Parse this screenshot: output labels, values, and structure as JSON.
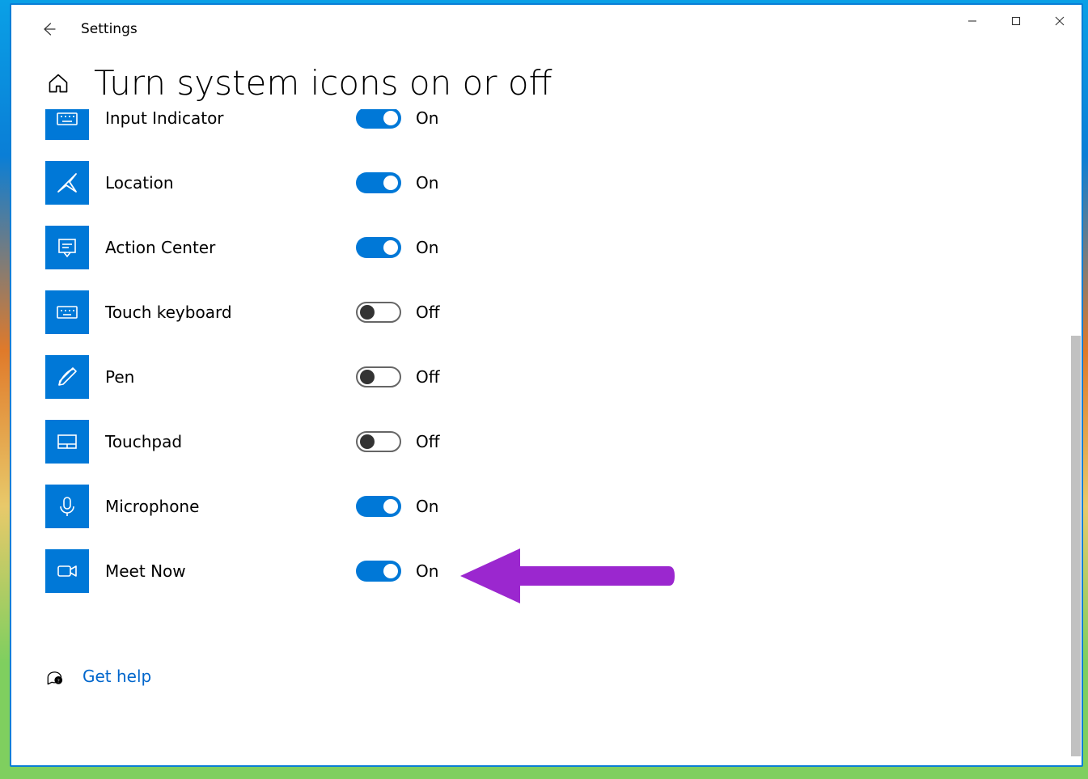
{
  "app": {
    "title": "Settings"
  },
  "page": {
    "title": "Turn system icons on or off"
  },
  "labels": {
    "on": "On",
    "off": "Off"
  },
  "rows": [
    {
      "icon": "keyboard-icon",
      "label": "Input Indicator",
      "state": "on"
    },
    {
      "icon": "location-icon",
      "label": "Location",
      "state": "on"
    },
    {
      "icon": "action-center-icon",
      "label": "Action Center",
      "state": "on"
    },
    {
      "icon": "touch-keyboard-icon",
      "label": "Touch keyboard",
      "state": "off"
    },
    {
      "icon": "pen-icon",
      "label": "Pen",
      "state": "off"
    },
    {
      "icon": "touchpad-icon",
      "label": "Touchpad",
      "state": "off"
    },
    {
      "icon": "microphone-icon",
      "label": "Microphone",
      "state": "on"
    },
    {
      "icon": "meet-now-icon",
      "label": "Meet Now",
      "state": "on"
    }
  ],
  "help": {
    "label": "Get help"
  },
  "annotation": {
    "color": "#9b27cf",
    "targetIndex": 7
  }
}
